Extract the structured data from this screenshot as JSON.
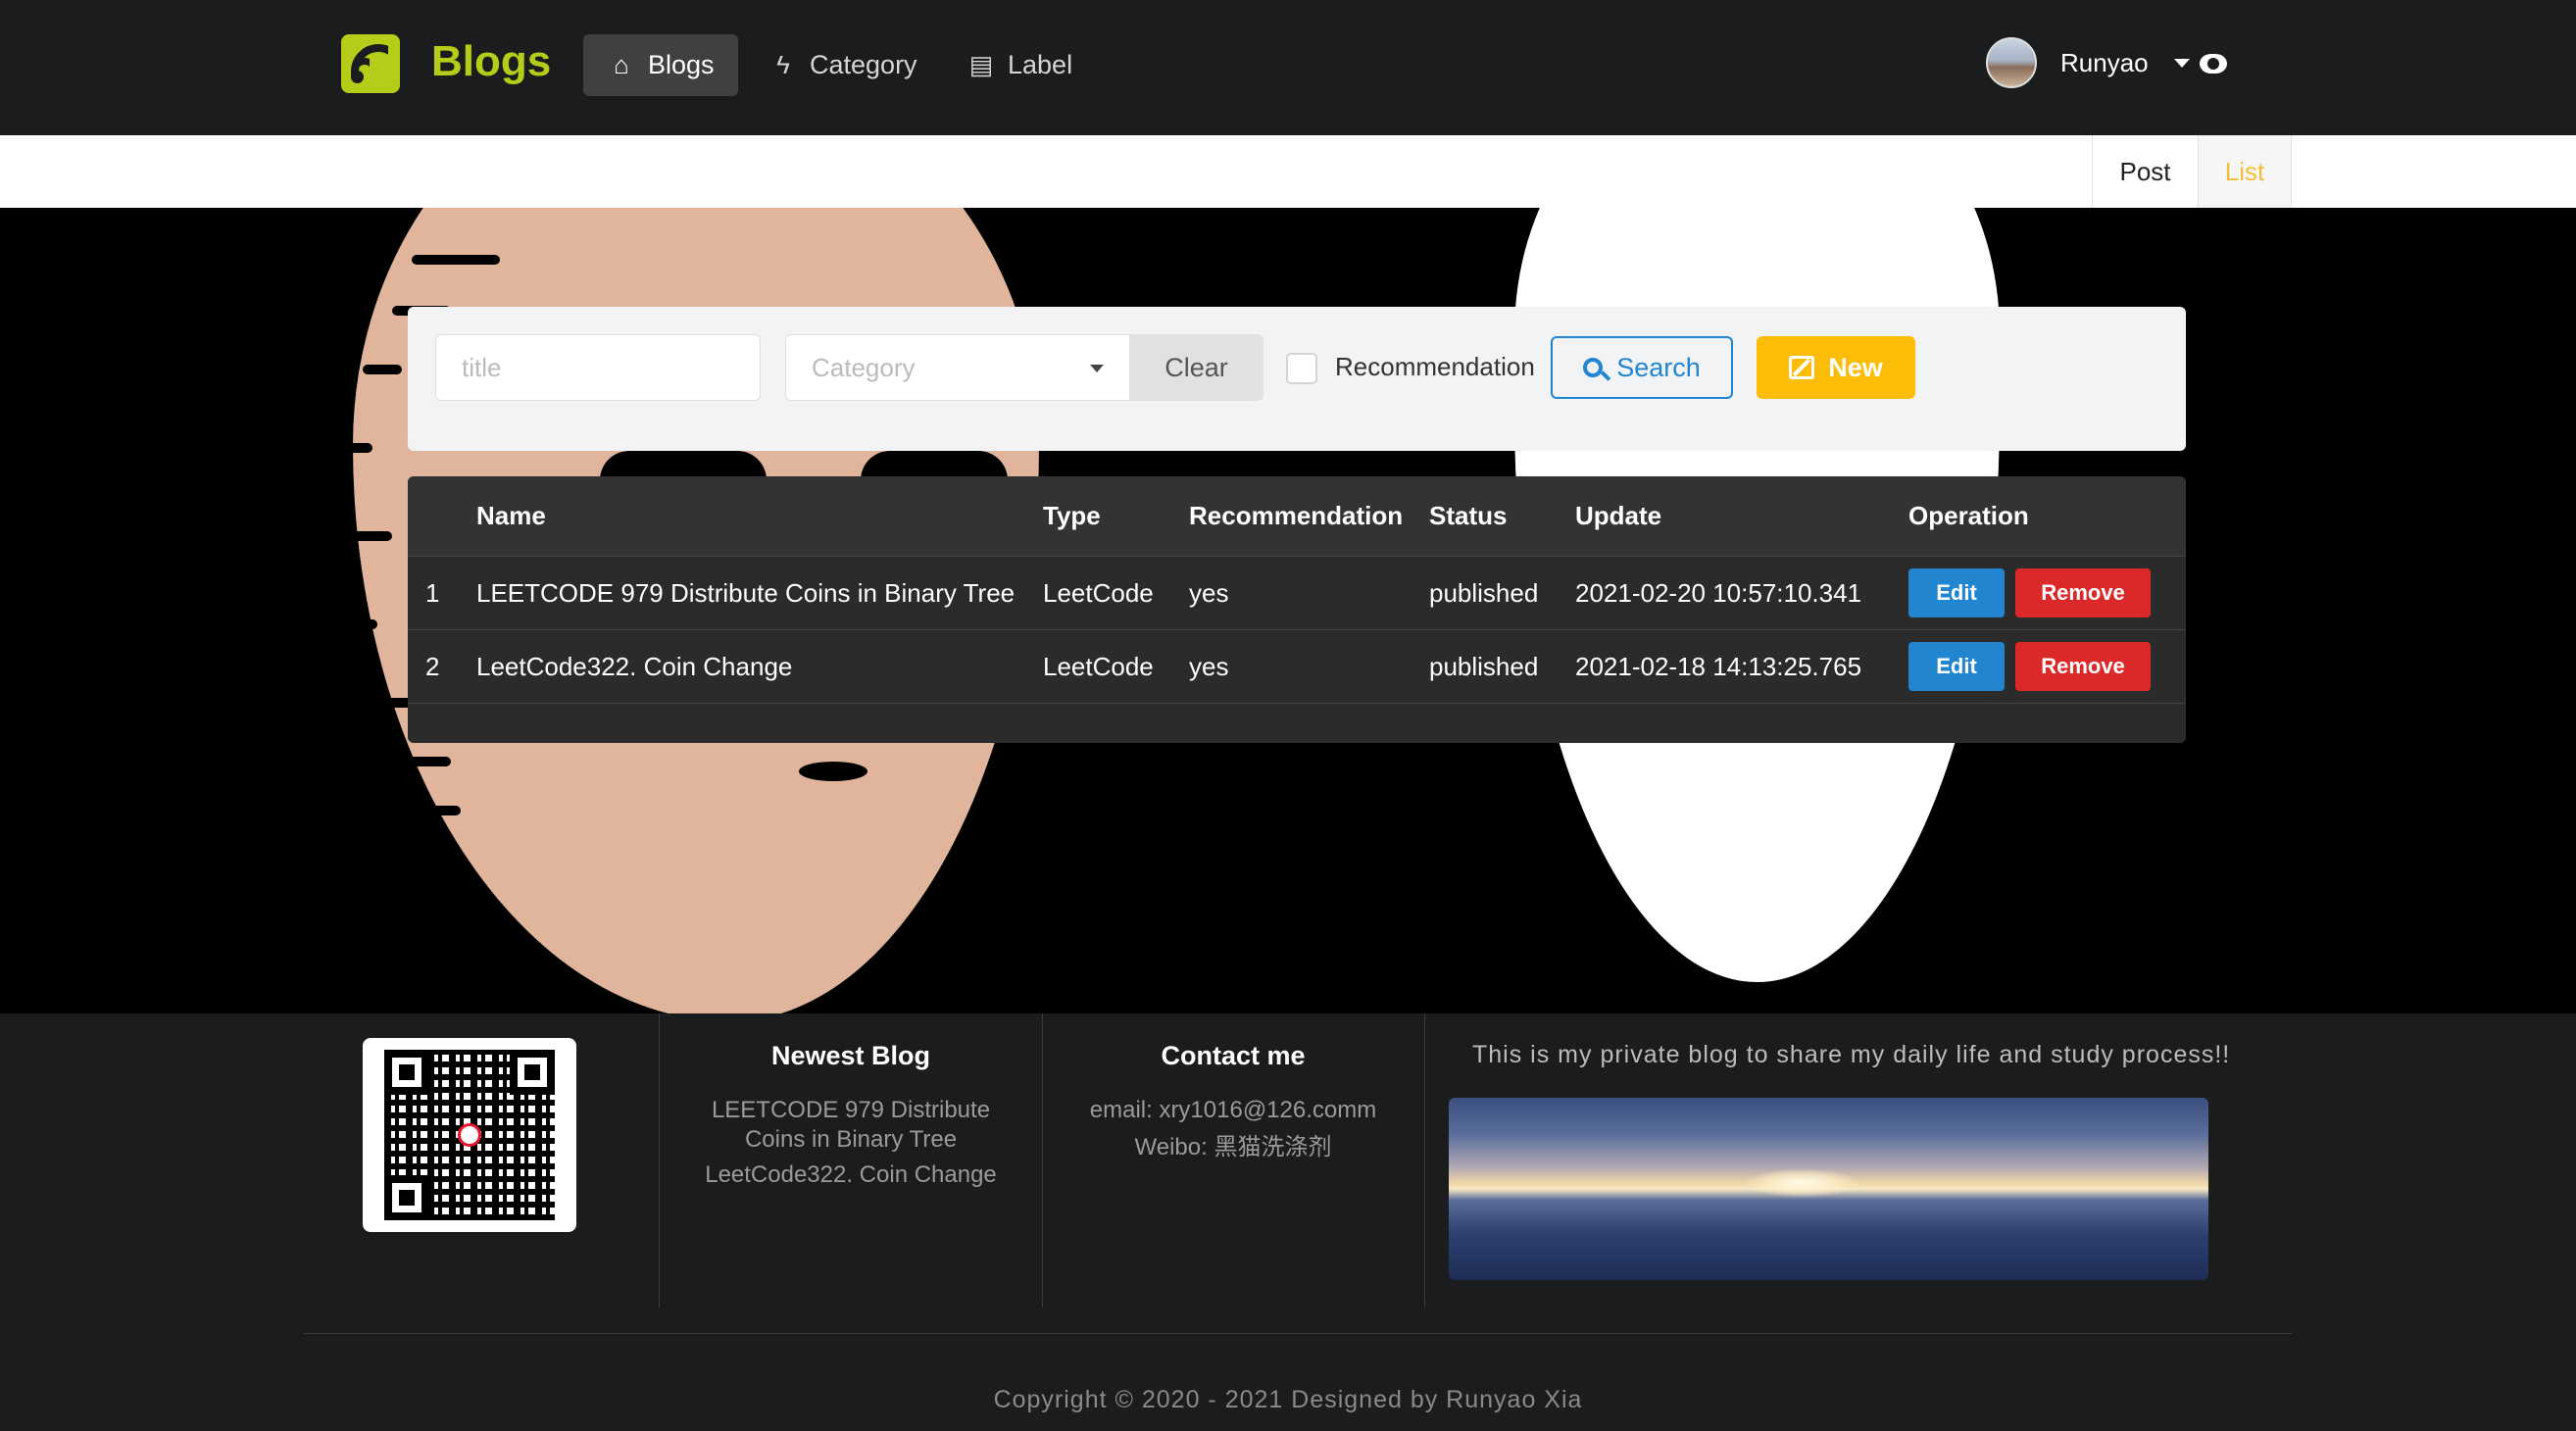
{
  "nav": {
    "brand": "Blogs",
    "items": [
      {
        "label": "Blogs",
        "icon": "home-icon"
      },
      {
        "label": "Category",
        "icon": "lightning-icon"
      },
      {
        "label": "Label",
        "icon": "archive-icon"
      }
    ],
    "user": "Runyao"
  },
  "submenu": {
    "items": [
      "Post",
      "List"
    ],
    "active": "List"
  },
  "search": {
    "title_placeholder": "title",
    "category_placeholder": "Category",
    "clear_label": "Clear",
    "recommend_label": "Recommendation",
    "search_label": "Search",
    "new_label": "New"
  },
  "table": {
    "headers": [
      "",
      "Name",
      "Type",
      "Recommendation",
      "Status",
      "Update",
      "Operation"
    ],
    "rows": [
      {
        "index": "1",
        "name": "LEETCODE 979 Distribute Coins in Binary Tree",
        "type": "LeetCode",
        "recommend": "yes",
        "status": "published",
        "update": "2021-02-20 10:57:10.341"
      },
      {
        "index": "2",
        "name": "LeetCode322. Coin Change",
        "type": "LeetCode",
        "recommend": "yes",
        "status": "published",
        "update": "2021-02-18 14:13:25.765"
      }
    ],
    "edit_label": "Edit",
    "remove_label": "Remove"
  },
  "footer": {
    "newest_title": "Newest Blog",
    "newest_items": [
      "LEETCODE 979 Distribute",
      "Coins in Binary Tree",
      "LeetCode322. Coin Change"
    ],
    "contact_title": "Contact me",
    "contact_email": "email: xry1016@126.comm",
    "contact_weibo": "Weibo: 黑猫洗涤剂",
    "about": "This is my private blog to share my daily life and study process!!",
    "copyright": "Copyright © 2020 - 2021 Designed by Runyao Xia"
  },
  "colors": {
    "brand": "#b5cc18",
    "primary": "#2185d0",
    "danger": "#db2828",
    "warning": "#fbbd08"
  }
}
